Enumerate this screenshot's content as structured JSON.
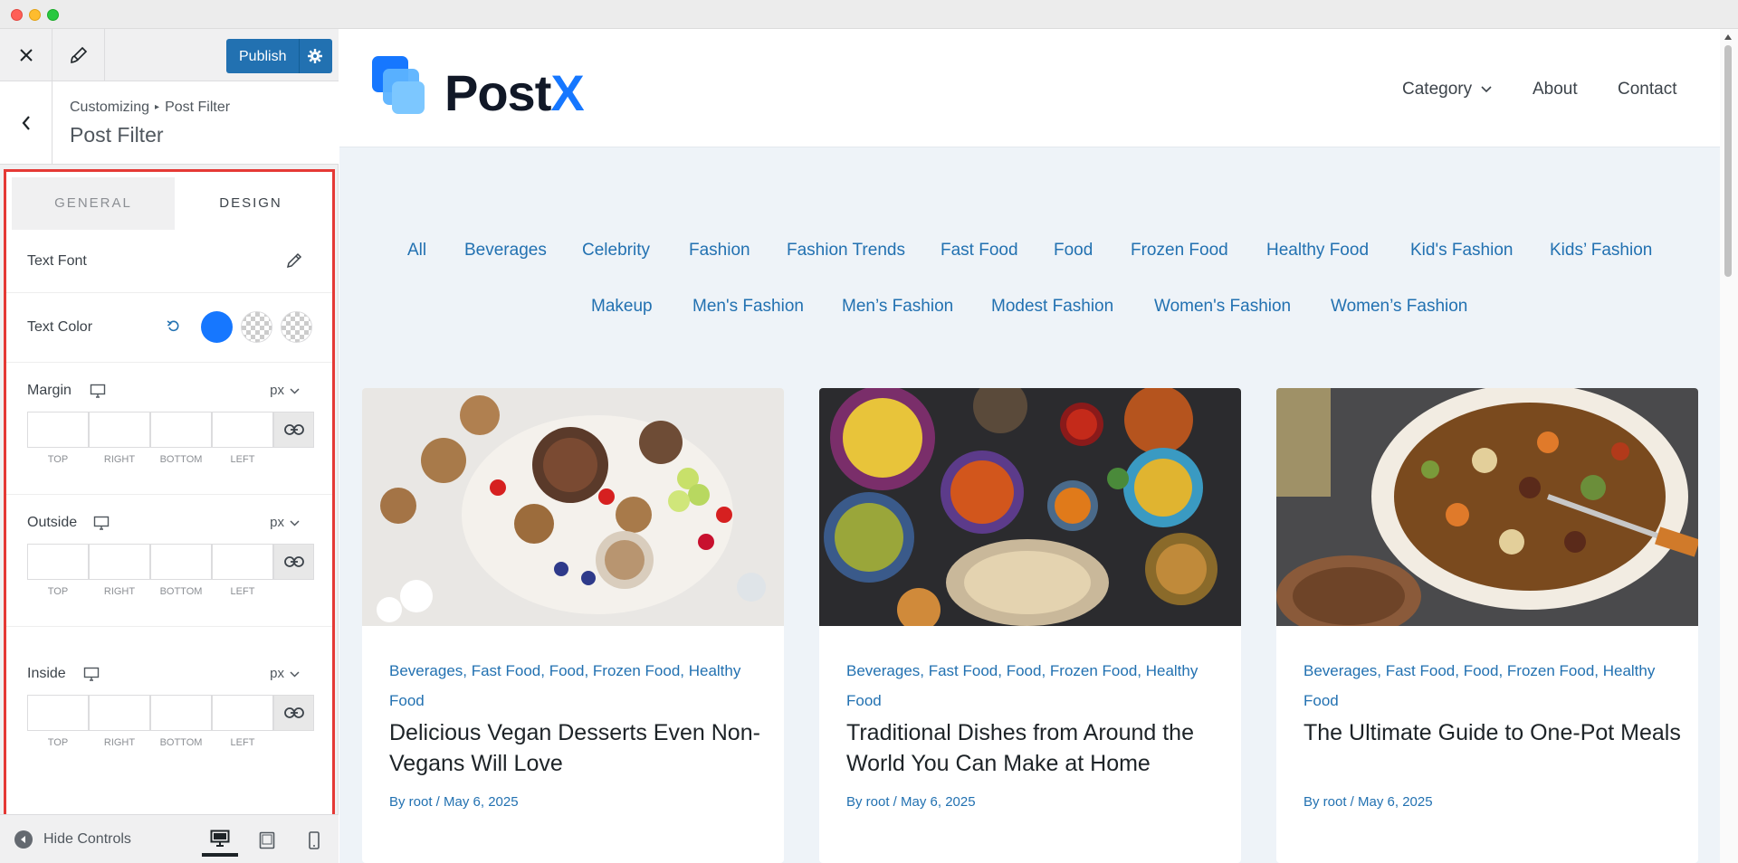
{
  "window": {
    "title": ""
  },
  "sidebar": {
    "publish_label": "Publish",
    "breadcrumb_root": "Customizing",
    "breadcrumb_current": "Post Filter",
    "section_title": "Post Filter",
    "tabs": [
      {
        "label": "GENERAL"
      },
      {
        "label": "DESIGN"
      }
    ],
    "text_font_label": "Text Font",
    "text_color_label": "Text Color",
    "colors": {
      "primary": "#1677ff"
    },
    "margin": {
      "label": "Margin",
      "unit": "px"
    },
    "outside": {
      "label": "Outside",
      "unit": "px"
    },
    "inside": {
      "label": "Inside",
      "unit": "px"
    },
    "dim_captions": [
      "TOP",
      "RIGHT",
      "BOTTOM",
      "LEFT"
    ],
    "hide_controls_label": "Hide Controls"
  },
  "site": {
    "logo_text_main": "Post",
    "logo_text_x": "X",
    "nav": [
      {
        "label": "Category"
      },
      {
        "label": "About"
      },
      {
        "label": "Contact"
      }
    ],
    "filters_row1": [
      "All",
      "Beverages",
      "Celebrity",
      "Fashion",
      "Fashion Trends",
      "Fast Food",
      "Food",
      "Frozen Food",
      "Healthy Food",
      "Kid's Fashion",
      "Kids’ Fashion"
    ],
    "filters_row2": [
      "Makeup",
      "Men's Fashion",
      "Men’s Fashion",
      "Modest Fashion",
      "Women's Fashion",
      "Women’s Fashion"
    ],
    "cards": [
      {
        "categories": "Beverages, Fast Food, Food, Frozen Food, Healthy Food",
        "title": "Delicious Vegan Desserts Even Non-Vegans Will Love",
        "meta": "By root / May 6, 2025"
      },
      {
        "categories": "Beverages, Fast Food, Food, Frozen Food, Healthy Food",
        "title": "Traditional Dishes from Around the World You Can Make at Home",
        "meta": "By root / May 6, 2025"
      },
      {
        "categories": "Beverages, Fast Food, Food, Frozen Food, Healthy Food",
        "title": "The Ultimate Guide to One-Pot Meals",
        "meta": "By root / May 6, 2025"
      }
    ]
  }
}
